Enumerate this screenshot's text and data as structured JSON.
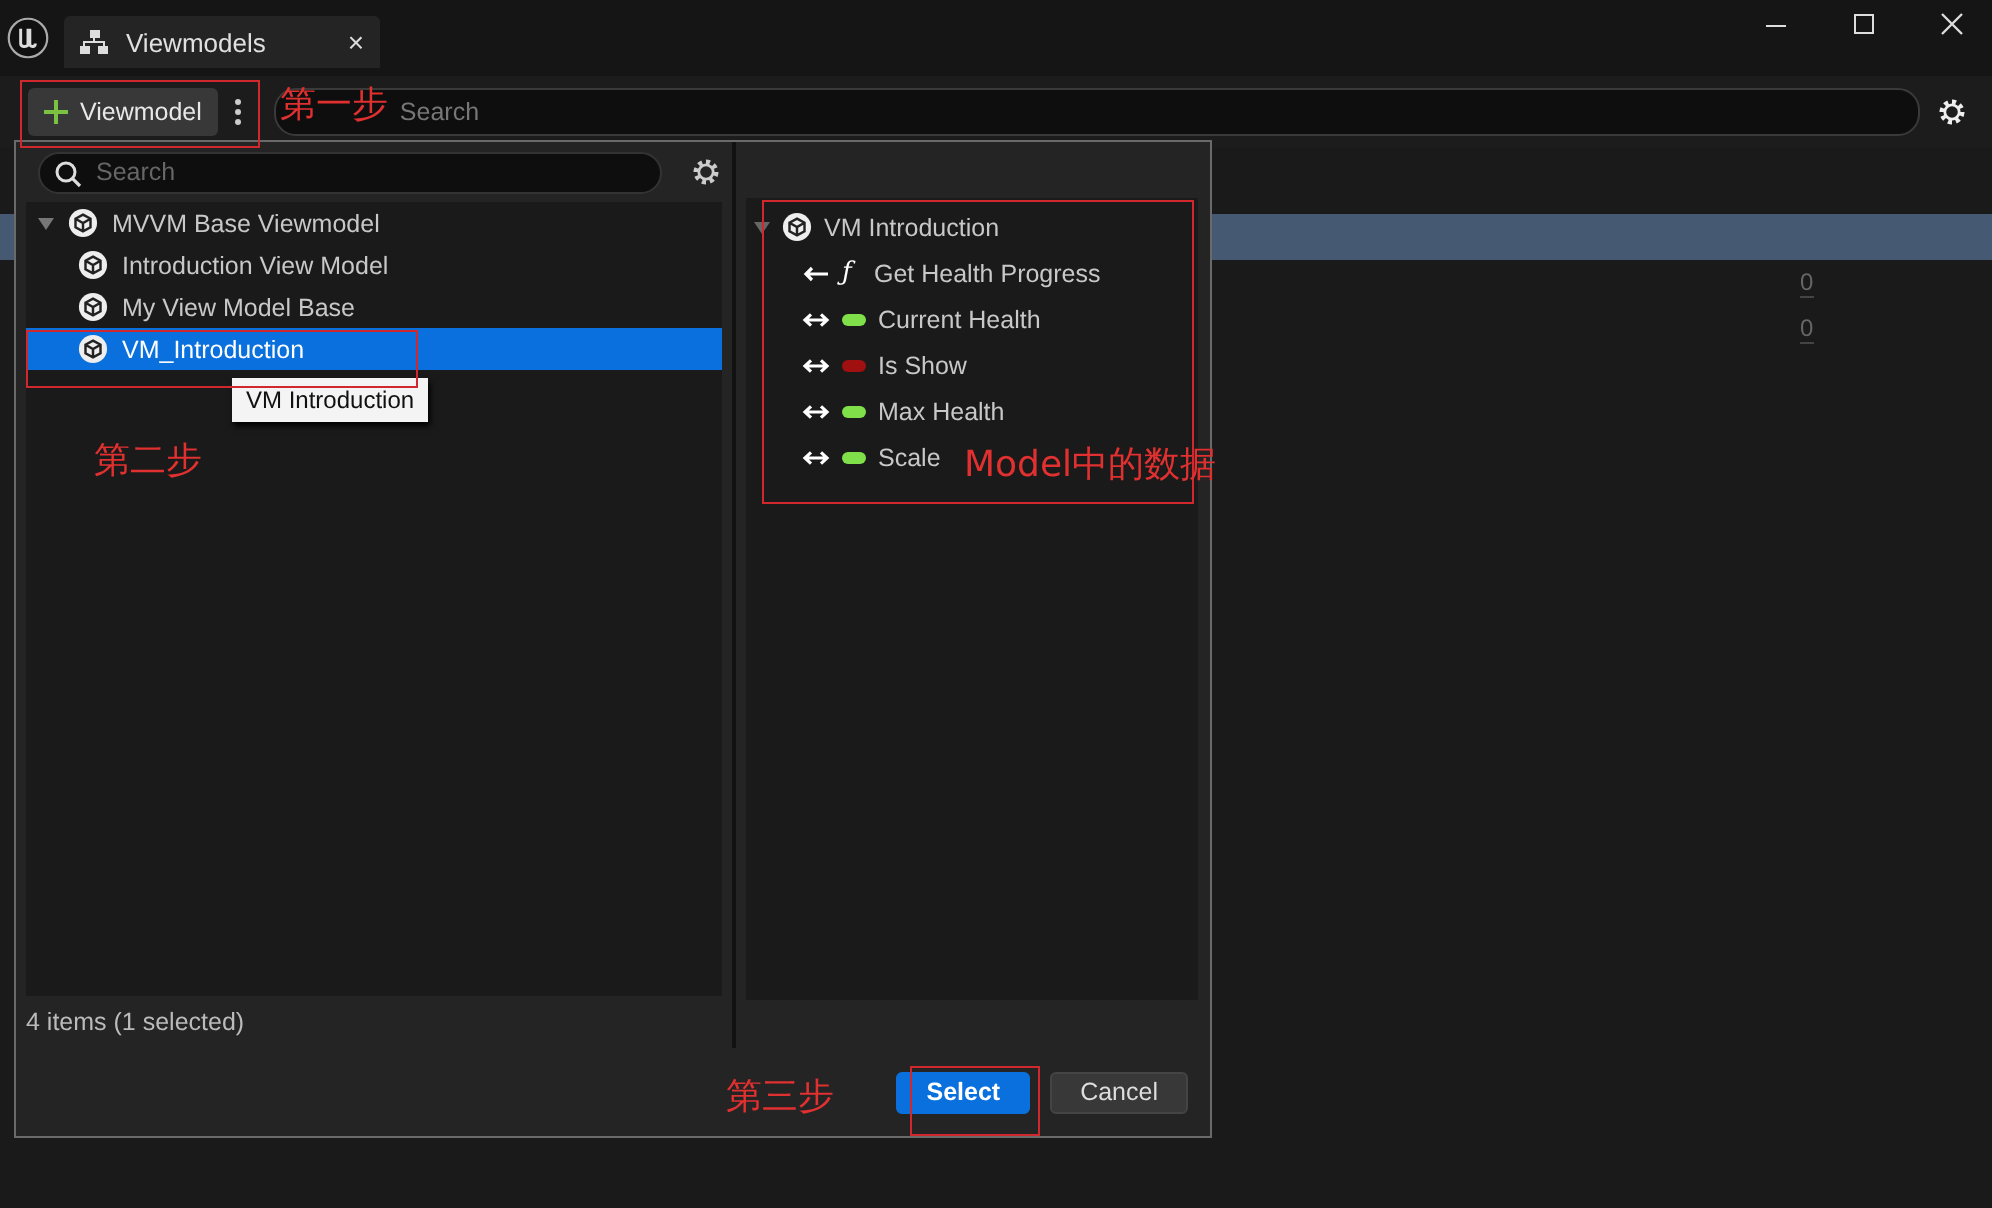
{
  "window": {
    "tab_title": "Viewmodels",
    "tab_close": "×"
  },
  "toolbar": {
    "add_button": "Viewmodel",
    "search_placeholder": "Search"
  },
  "background_values": [
    "0",
    "0"
  ],
  "dialog": {
    "search_placeholder": "Search",
    "tree": [
      {
        "label": "MVVM Base Viewmodel",
        "expanded": true,
        "selected": false,
        "children": [
          {
            "label": "Introduction View Model",
            "selected": false
          },
          {
            "label": "My View Model Base",
            "selected": false
          },
          {
            "label": "VM_Introduction",
            "selected": true
          }
        ]
      }
    ],
    "tooltip": "VM Introduction",
    "properties": {
      "label": "VM Introduction",
      "expanded": true,
      "children": [
        {
          "kind": "function",
          "glyph": "ƒ",
          "label": "Get Health Progress"
        },
        {
          "kind": "property",
          "color": "#7fe04a",
          "label": "Current Health"
        },
        {
          "kind": "property",
          "color": "#a01010",
          "label": "Is Show"
        },
        {
          "kind": "property",
          "color": "#7fe04a",
          "label": "Max Health"
        },
        {
          "kind": "property",
          "color": "#7fe04a",
          "label": "Scale"
        }
      ]
    },
    "status": "4 items (1 selected)",
    "buttons": [
      {
        "label": "Select",
        "primary": true
      },
      {
        "label": "Cancel",
        "primary": false
      }
    ]
  },
  "annotations": [
    {
      "text": "第一步"
    },
    {
      "text": "第二步"
    },
    {
      "text": "Model中的数据"
    },
    {
      "text": "第三步"
    }
  ]
}
